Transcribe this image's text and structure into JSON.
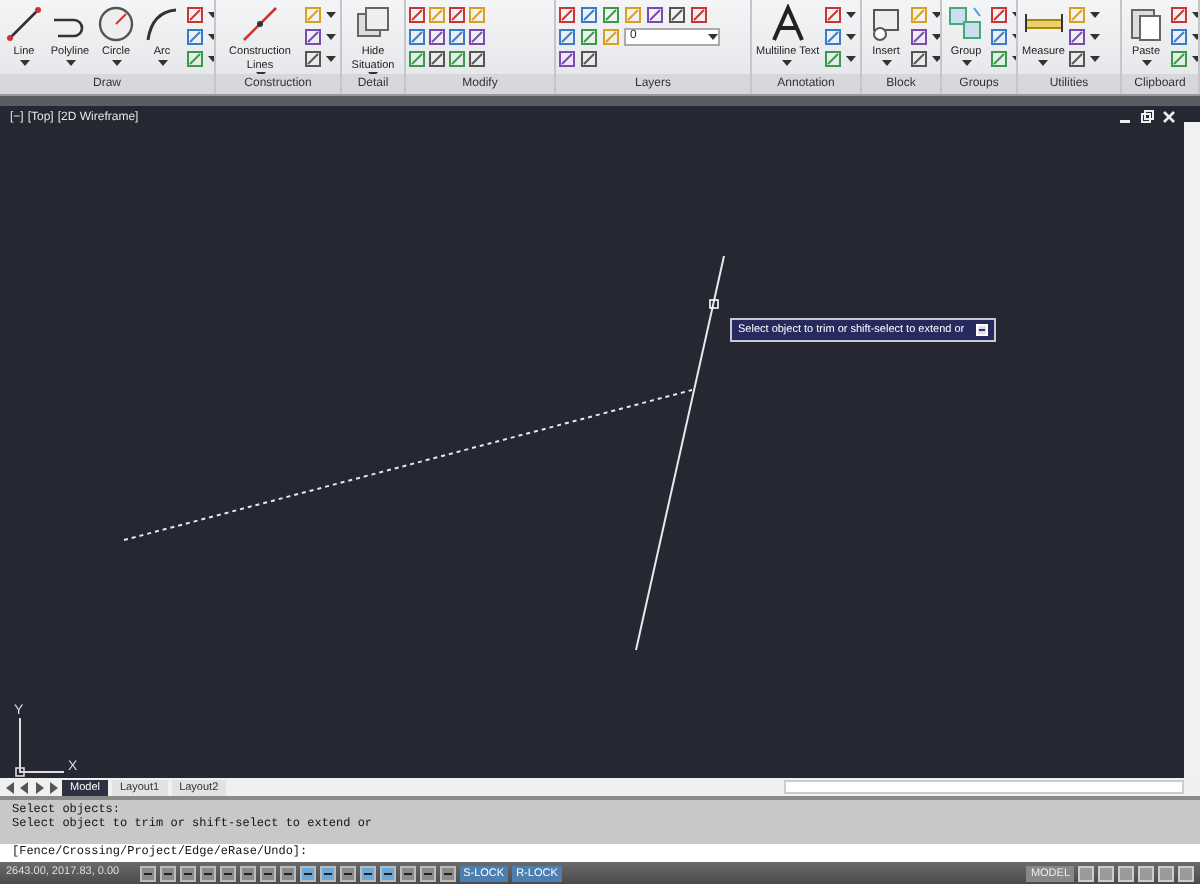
{
  "ribbon": {
    "panels": [
      {
        "label": "Draw",
        "large_buttons": [
          {
            "label": "Line"
          },
          {
            "label": "Polyline"
          },
          {
            "label": "Circle"
          },
          {
            "label": "Arc"
          }
        ]
      },
      {
        "label": "Construction",
        "large_buttons": [
          {
            "label": "Construction Lines"
          }
        ]
      },
      {
        "label": "Detail",
        "large_buttons": [
          {
            "label": "Hide Situation"
          }
        ]
      },
      {
        "label": "Modify"
      },
      {
        "label": "Layers",
        "layer_dropdown": {
          "value": "0"
        }
      },
      {
        "label": "Annotation",
        "large_buttons": [
          {
            "label": "Multiline Text"
          }
        ]
      },
      {
        "label": "Block",
        "large_buttons": [
          {
            "label": "Insert"
          }
        ]
      },
      {
        "label": "Groups",
        "large_buttons": [
          {
            "label": "Group"
          }
        ]
      },
      {
        "label": "Utilities",
        "large_buttons": [
          {
            "label": "Measure"
          }
        ]
      },
      {
        "label": "Clipboard",
        "large_buttons": [
          {
            "label": "Paste"
          }
        ]
      }
    ]
  },
  "viewport": {
    "controls": [
      {
        "label": "[−]"
      },
      {
        "label": "[Top]"
      },
      {
        "label": "[2D Wireframe]"
      }
    ],
    "tooltip": "Select object to trim or shift-select to extend or",
    "ucs": {
      "y_label": "Y",
      "x_label": "X"
    }
  },
  "layout_tabs": [
    {
      "label": "Model",
      "selected": true
    },
    {
      "label": "Layout1",
      "selected": false
    },
    {
      "label": "Layout2",
      "selected": false
    }
  ],
  "command_line": {
    "history": [
      "Select objects:",
      "Select object to trim or shift-select to extend or"
    ],
    "prompt": "[Fence/Crossing/Project/Edge/eRase/Undo]:"
  },
  "status_bar": {
    "coordinates": "2643.00, 2017.83, 0.00",
    "lock_buttons": [
      {
        "label": "S-LOCK"
      },
      {
        "label": "R-LOCK"
      }
    ],
    "space": "MODEL"
  }
}
